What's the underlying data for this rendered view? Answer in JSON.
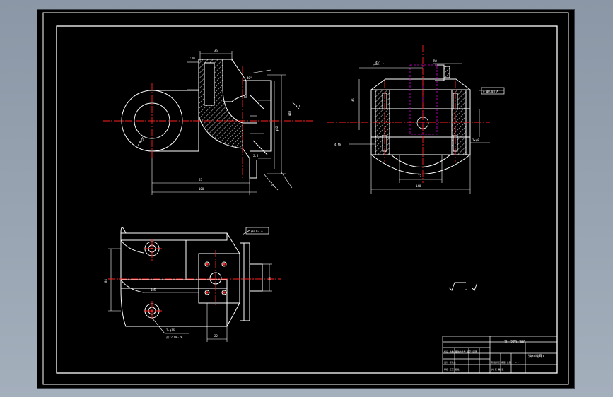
{
  "title_block": {
    "drawing_number": "ZL 270-300",
    "part_name": "油缸端耳1",
    "left_row_text": "标记 处数 更改文件号 签字 日期",
    "process_row": "设计 标准化",
    "approve_row": "审核 工艺 批准",
    "stage_row": "阶段标记 重量 比例",
    "scale": "1:1",
    "sheet_row": "共 张 第 张"
  },
  "roughness_symbols": [
    "√",
    "√"
  ],
  "colors": {
    "background": "#000000",
    "outline": "#ffffff",
    "centerline": "#ff0000",
    "dimension": "#ffff00",
    "hidden": "#cc00cc"
  }
}
